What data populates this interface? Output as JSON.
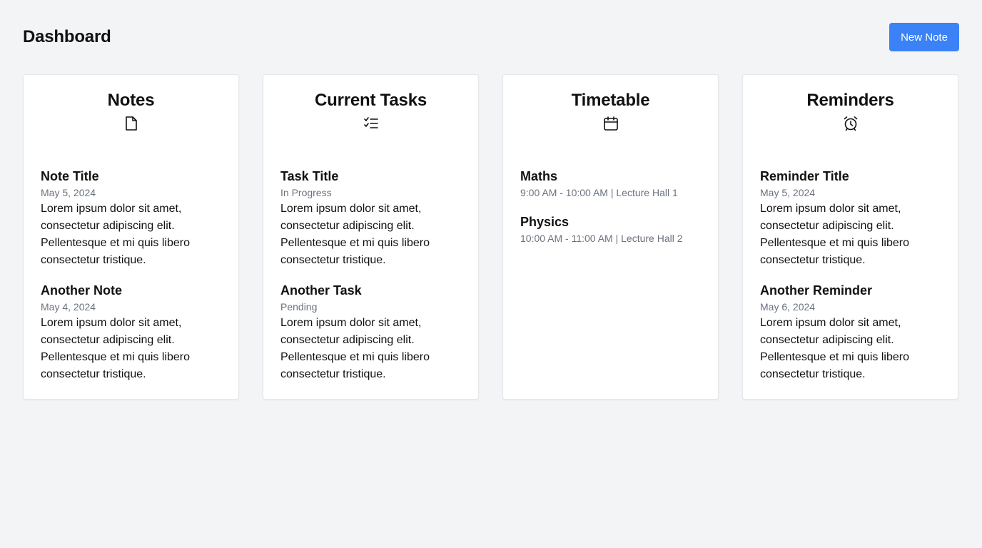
{
  "header": {
    "title": "Dashboard",
    "new_note_label": "New Note",
    "accent_color": "#3b82f6"
  },
  "notes": {
    "title": "Notes",
    "icon": "document-icon",
    "items": [
      {
        "title": "Note Title",
        "date": "May 5, 2024",
        "body": "Lorem ipsum dolor sit amet, consectetur adipiscing elit. Pellentesque et mi quis libero consectetur tristique."
      },
      {
        "title": "Another Note",
        "date": "May 4, 2024",
        "body": "Lorem ipsum dolor sit amet, consectetur adipiscing elit. Pellentesque et mi quis libero consectetur tristique."
      }
    ]
  },
  "tasks": {
    "title": "Current Tasks",
    "icon": "checklist-icon",
    "items": [
      {
        "title": "Task Title",
        "status": "In Progress",
        "body": "Lorem ipsum dolor sit amet, consectetur adipiscing elit. Pellentesque et mi quis libero consectetur tristique."
      },
      {
        "title": "Another Task",
        "status": "Pending",
        "body": "Lorem ipsum dolor sit amet, consectetur adipiscing elit. Pellentesque et mi quis libero consectetur tristique."
      }
    ]
  },
  "timetable": {
    "title": "Timetable",
    "icon": "calendar-icon",
    "items": [
      {
        "subject": "Maths",
        "detail": "9:00 AM - 10:00 AM | Lecture Hall 1"
      },
      {
        "subject": "Physics",
        "detail": "10:00 AM - 11:00 AM | Lecture Hall 2"
      }
    ]
  },
  "reminders": {
    "title": "Reminders",
    "icon": "alarm-clock-icon",
    "items": [
      {
        "title": "Reminder Title",
        "date": "May 5, 2024",
        "body": "Lorem ipsum dolor sit amet, consectetur adipiscing elit. Pellentesque et mi quis libero consectetur tristique."
      },
      {
        "title": "Another Reminder",
        "date": "May 6, 2024",
        "body": "Lorem ipsum dolor sit amet, consectetur adipiscing elit. Pellentesque et mi quis libero consectetur tristique."
      }
    ]
  }
}
